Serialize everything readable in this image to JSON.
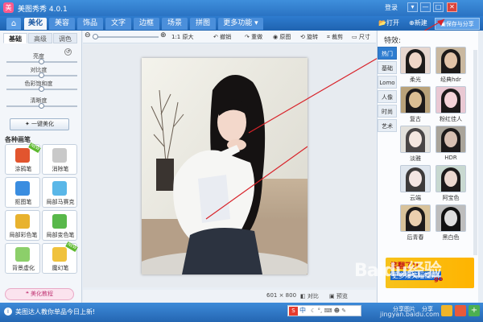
{
  "app": {
    "title": "美图秀秀 4.0.1",
    "login": "登录"
  },
  "window": {
    "menu": "▾",
    "minimize": "—",
    "maximize": "□",
    "close": "✕"
  },
  "nav": {
    "home_icon": "home-icon",
    "tabs": [
      "美化",
      "美容",
      "饰品",
      "文字",
      "边框",
      "场景",
      "拼图",
      "更多功能 ▾"
    ],
    "active_tab": "美化",
    "open": "打开",
    "new": "新建",
    "save": "保存与分享"
  },
  "left": {
    "subtabs": [
      "基础",
      "高级",
      "调色"
    ],
    "sliders": [
      {
        "label": "亮度",
        "level": 0.5
      },
      {
        "label": "对比度",
        "level": 0.5
      },
      {
        "label": "色彩饱和度",
        "level": 0.5
      },
      {
        "label": "清晰度",
        "level": 0.5
      }
    ],
    "one_click": "一键美化",
    "brushes_title": "各种画笔",
    "brushes": [
      {
        "label": "涂鸦笔",
        "color": "#e2552e",
        "new": true
      },
      {
        "label": "消除笔",
        "color": "#c9c9c9",
        "new": false
      },
      {
        "label": "抠图笔",
        "color": "#3a8de0",
        "new": false
      },
      {
        "label": "局部马赛克",
        "color": "#5ab7e8",
        "new": false
      },
      {
        "label": "局部彩色笔",
        "color": "#e8b22e",
        "new": false
      },
      {
        "label": "局部变色笔",
        "color": "#58b84a",
        "new": false
      },
      {
        "label": "背景虚化",
        "color": "#8ccf6a",
        "new": false
      },
      {
        "label": "魔幻笔",
        "color": "#f0c23c",
        "new": true
      }
    ],
    "new_badge": "NEW",
    "tutorial": "美化教程"
  },
  "toolbar": {
    "actual_size": "1:1 原大",
    "undo": "撤销",
    "redo": "重做",
    "original": "原图",
    "rotate": "旋转",
    "crop": "裁剪",
    "resize": "尺寸"
  },
  "canvas": {
    "dimensions": "601 × 800",
    "compare": "对比",
    "preview": "预览"
  },
  "right": {
    "title": "特效:",
    "categories": [
      "热门",
      "基础",
      "Lomo",
      "人像",
      "时尚",
      "艺术"
    ],
    "active_category": "热门",
    "effects": [
      "柔光",
      "经典hdr",
      "复古",
      "粉红佳人",
      "淡雅",
      "HDR",
      "云端",
      "阿宝色",
      "后青春",
      "黑白色"
    ],
    "ad_line1": "笑翻了!!",
    "ad_line2": "更多爆笑短视频!",
    "ad_line3": "go",
    "share_pics": "分享图片",
    "share": "分享"
  },
  "bottom": {
    "message": "美图达人教你单品今日上新!",
    "ime_s": "S",
    "ime_zh": "中",
    "ime_rest": "☾ °, ⌨ ☻ ✎"
  },
  "watermark": {
    "text": "Baidu经验",
    "url": "jingyan.baidu.com"
  }
}
